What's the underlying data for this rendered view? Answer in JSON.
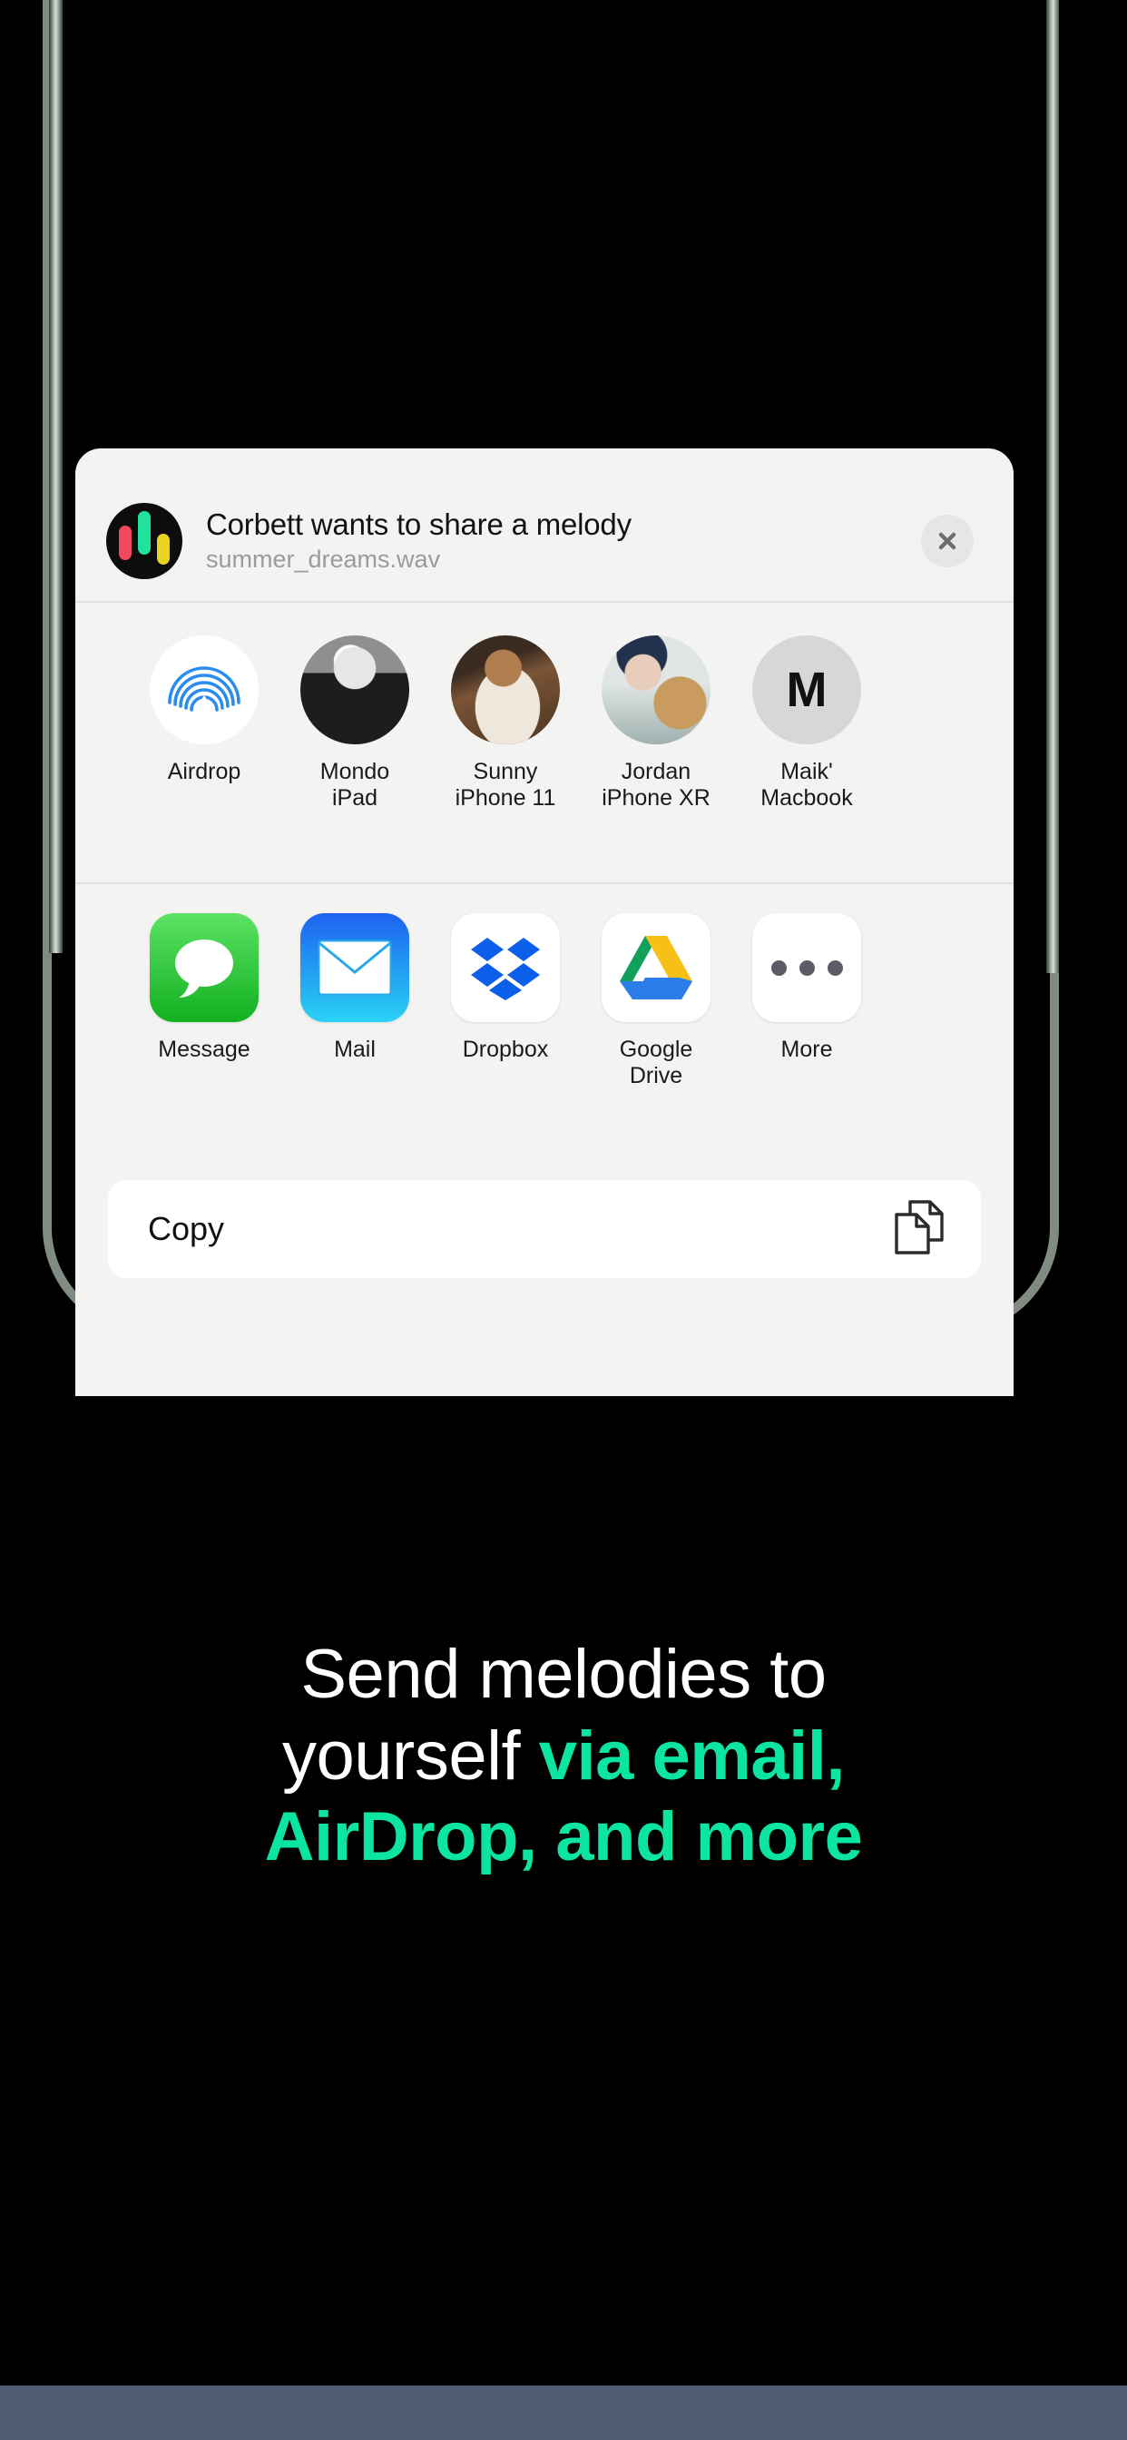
{
  "device": {
    "name": "iphone-mockup"
  },
  "share_sheet": {
    "title": "Corbett wants to share a melody",
    "subtitle": "summer_dreams.wav",
    "app_icon_name": "melody-equalizer-icon",
    "close_label": "✕",
    "contacts": [
      {
        "icon": "airdrop-icon",
        "name": "Airdrop",
        "device": ""
      },
      {
        "icon": "contact-photo",
        "name": "Mondo",
        "device": "iPad"
      },
      {
        "icon": "contact-photo",
        "name": "Sunny",
        "device": "iPhone 11"
      },
      {
        "icon": "contact-photo",
        "name": "Jordan",
        "device": "iPhone XR"
      },
      {
        "icon": "monogram",
        "initial": "M",
        "name": "Maik'",
        "device": "Macbook"
      }
    ],
    "apps": [
      {
        "icon": "messages-icon",
        "name": "Message",
        "name2": ""
      },
      {
        "icon": "mail-icon",
        "name": "Mail",
        "name2": ""
      },
      {
        "icon": "dropbox-icon",
        "name": "Dropbox",
        "name2": ""
      },
      {
        "icon": "google-drive-icon",
        "name": "Google",
        "name2": "Drive"
      },
      {
        "icon": "more-dots-icon",
        "name": "More",
        "name2": ""
      }
    ],
    "copy_row": {
      "label": "Copy",
      "icon": "copy-pages-icon"
    }
  },
  "headline": {
    "line1": "Send melodies to",
    "line2_plain": "yourself ",
    "line2_accent": "via email,",
    "line3_accent": "AirDrop, and more"
  },
  "colors": {
    "accent": "#0ce5a2",
    "background": "#000000",
    "sheet": "#f3f3f1",
    "bottom_band": "#4e5b73"
  }
}
